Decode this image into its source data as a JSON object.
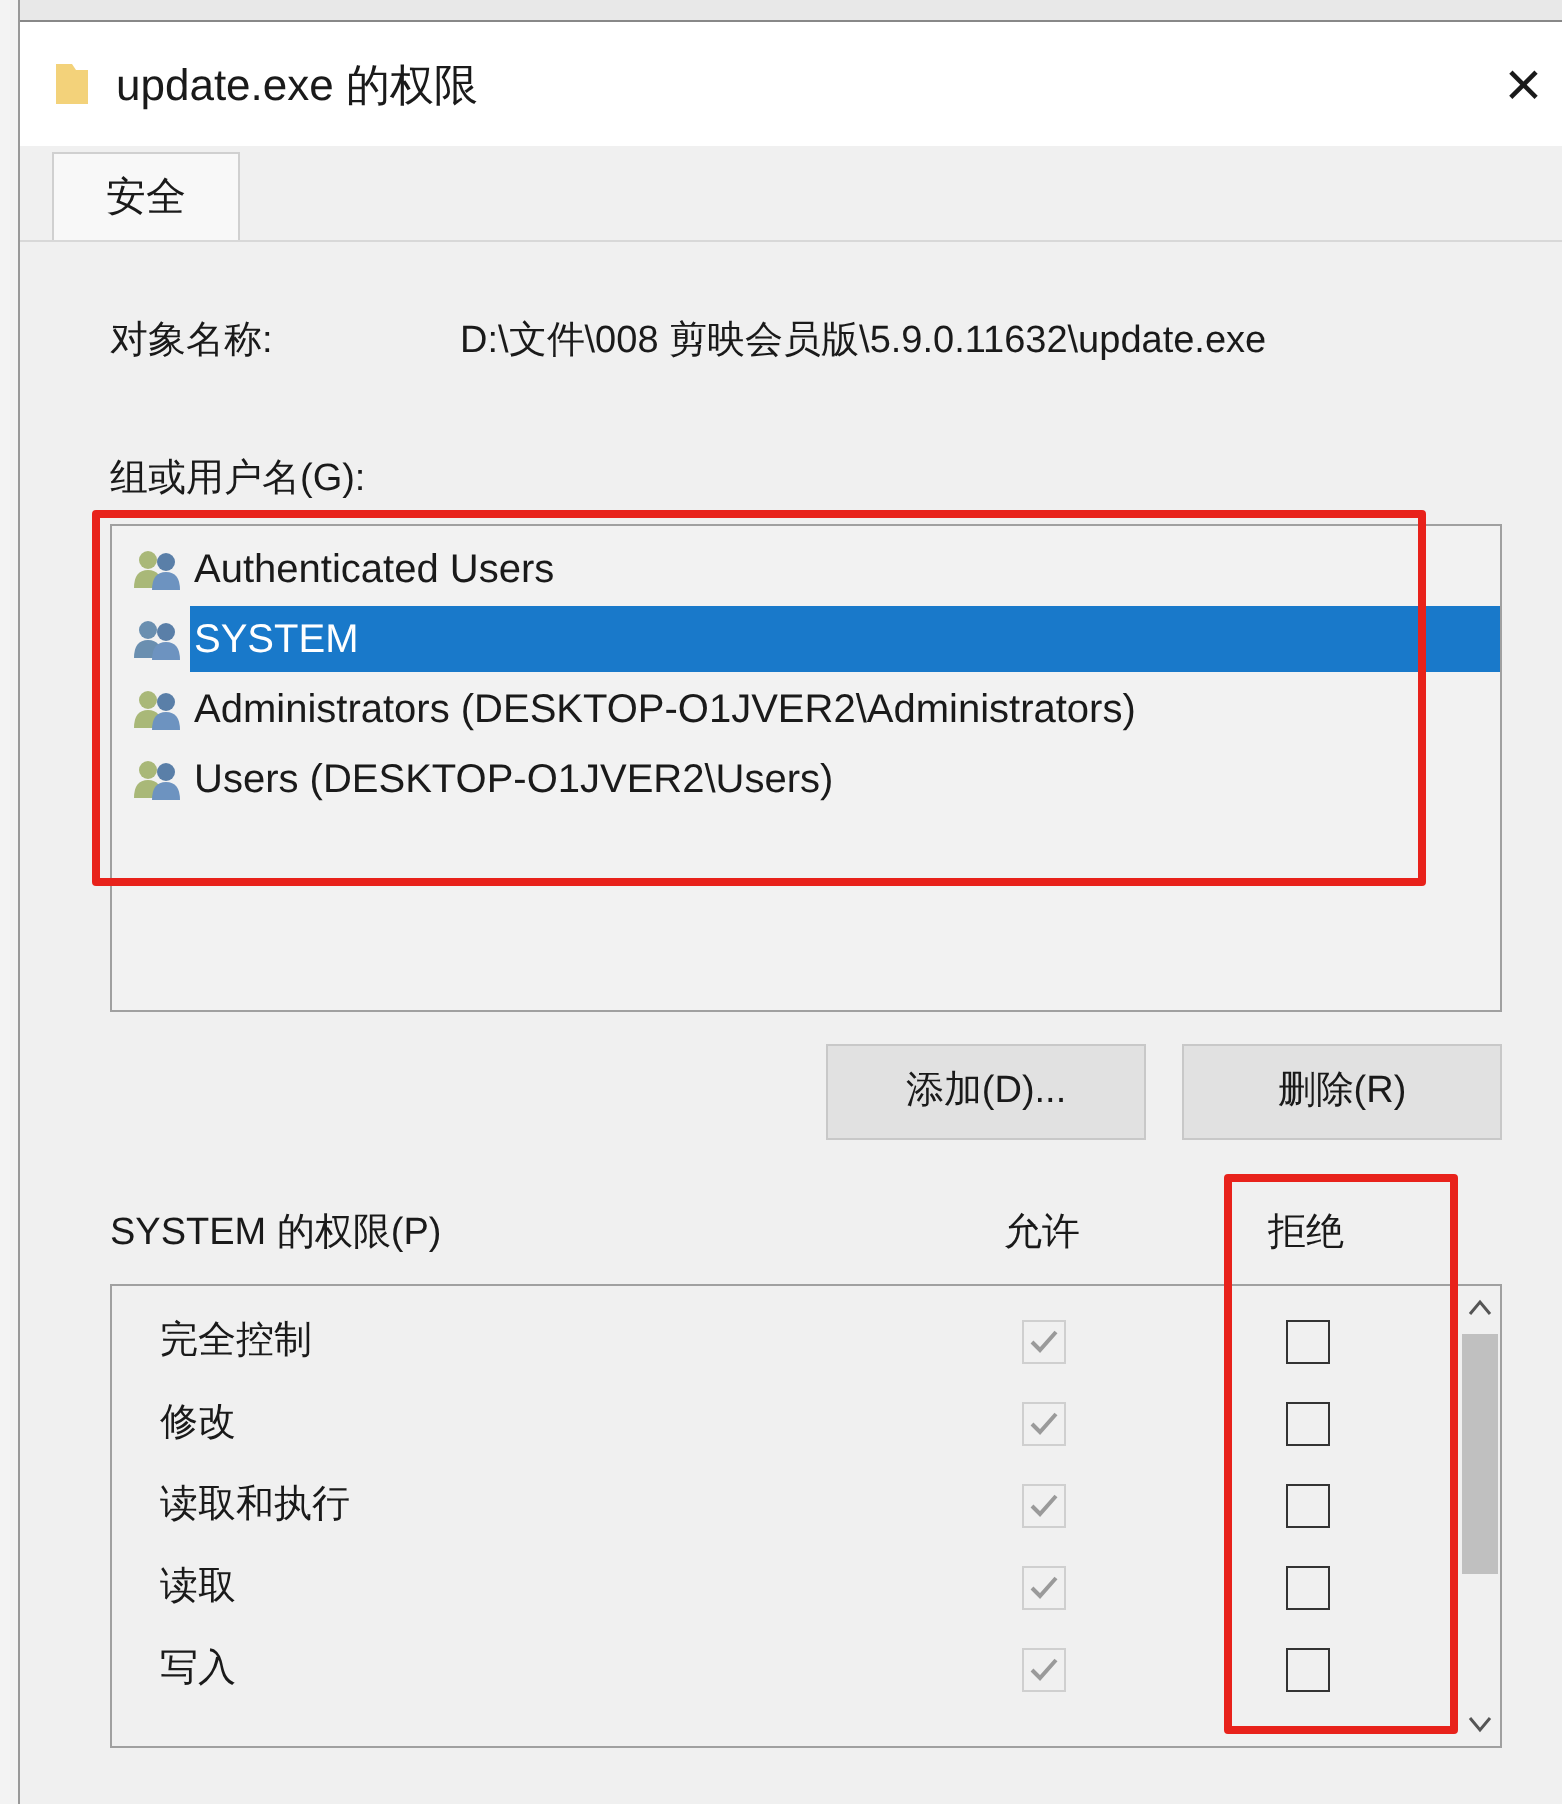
{
  "window": {
    "title": "update.exe 的权限",
    "close": "×"
  },
  "tabs": [
    {
      "label": "安全",
      "selected": true
    }
  ],
  "object_name": {
    "label": "对象名称:",
    "value": "D:\\文件\\008 剪映会员版\\5.9.0.11632\\update.exe"
  },
  "groups": {
    "label": "组或用户名(G):",
    "items": [
      {
        "name": "Authenticated Users",
        "selected": false
      },
      {
        "name": "SYSTEM",
        "selected": true
      },
      {
        "name": "Administrators (DESKTOP-O1JVER2\\Administrators)",
        "selected": false
      },
      {
        "name": "Users (DESKTOP-O1JVER2\\Users)",
        "selected": false
      }
    ]
  },
  "buttons": [
    "添加(D)...",
    "删除(R)"
  ],
  "permissions": {
    "label": "SYSTEM 的权限(P)",
    "allow_header": "允许",
    "deny_header": "拒绝",
    "rows": [
      {
        "name": "完全控制",
        "allow_checked": true,
        "allow_disabled": true,
        "deny_checked": false
      },
      {
        "name": "修改",
        "allow_checked": true,
        "allow_disabled": true,
        "deny_checked": false
      },
      {
        "name": "读取和执行",
        "allow_checked": true,
        "allow_disabled": true,
        "deny_checked": false
      },
      {
        "name": "读取",
        "allow_checked": true,
        "allow_disabled": true,
        "deny_checked": false
      },
      {
        "name": "写入",
        "allow_checked": true,
        "allow_disabled": true,
        "deny_checked": false
      }
    ]
  }
}
